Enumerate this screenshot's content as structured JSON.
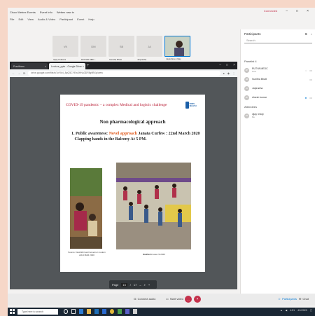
{
  "teams": {
    "window_title": "Cisco Webex Events",
    "tab2": "Event Info",
    "tab3": "Webex new in",
    "connected": "Connected",
    "menu": [
      "File",
      "Edit",
      "View",
      "Audio & Video",
      "Participant",
      "Event",
      "Help"
    ]
  },
  "video_tiles": [
    {
      "initials": "VK",
      "name": "Vijay Kulkarni"
    },
    {
      "initials": "DM",
      "name": "DOOHD MBC..."
    },
    {
      "initials": "SB",
      "name": "Sunitha Bhatt"
    },
    {
      "initials": "JA",
      "name": "Jaipradha"
    },
    {
      "initials": "",
      "name": "Jayashree Uday"
    }
  ],
  "browser": {
    "tabs": [
      {
        "label": "Pravitham"
      },
      {
        "label": "Lecture_pptx - Google Drive"
      }
    ],
    "url": "drive.google.com/file/d/1xYkN_8pQ5CYEw3HNu3DF8g9BXp/view"
  },
  "slide": {
    "title": "COVID-19 pandemic – a complex Medical and logistic challenge",
    "logo_text": "KDMS HEALTH",
    "subtitle": "Non pharmacological approach",
    "point_number": "1.",
    "point_lead": "Public awareness:",
    "point_highlight": "Novel approach",
    "point_rest": "Janata Curfew : 22nd March 2020",
    "point_line2": "Clapping hands in the Balcony At 5 PM.",
    "caption1": "Source: Deshikhil well Governor modern 22nd MAR 2020",
    "caption2_bold": "Radhesh",
    "caption2_rest": "Lane 22 2020"
  },
  "pdf": {
    "page_label": "Page",
    "page": "15",
    "total": "17"
  },
  "panel": {
    "title": "Participants",
    "search_placeholder": "Search",
    "section_panelists": "Panelist 4",
    "panelists": [
      {
        "initials": "RP",
        "name": "RUTVA MEDC",
        "role": "Host"
      },
      {
        "initials": "SB",
        "name": "Sunitha Bhatt",
        "role": ""
      },
      {
        "initials": "JA",
        "name": "Jaipradha",
        "role": ""
      },
      {
        "initials": "DK",
        "name": "dinesh kumar",
        "role": ""
      }
    ],
    "section_attendees": "Attendees",
    "attendees": [
      {
        "initials": "VR",
        "name": "vijay reddy",
        "role": "Me"
      }
    ]
  },
  "meeting_bar": {
    "audio": "Connect audio",
    "video": "Start video",
    "participants": "Participants",
    "chat": "Chat"
  },
  "taskbar": {
    "search": "Type here to search",
    "time": "4:51",
    "date": "4/1/2020"
  }
}
